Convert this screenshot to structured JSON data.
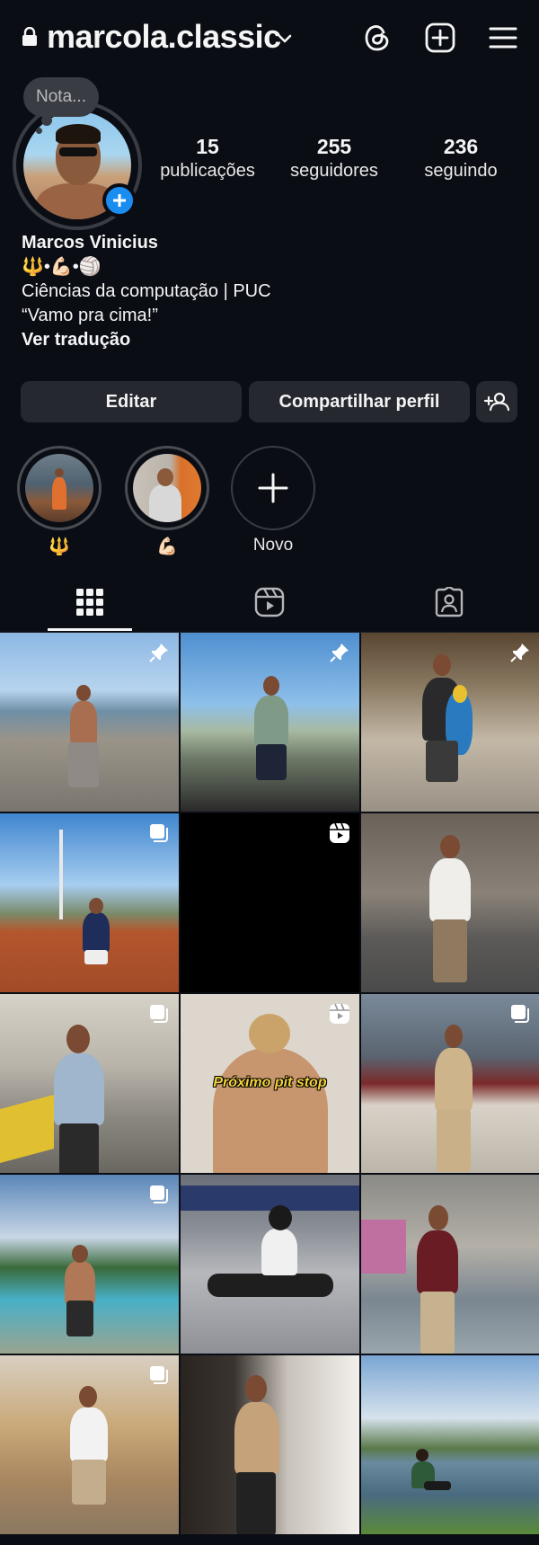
{
  "header": {
    "username": "marcola.classic",
    "icons": [
      "lock-icon",
      "chevron-down-icon",
      "threads-icon",
      "create-post-icon",
      "menu-icon"
    ]
  },
  "profile": {
    "note_placeholder": "Nota...",
    "stats": [
      {
        "value": "15",
        "label": "publicações"
      },
      {
        "value": "255",
        "label": "seguidores"
      },
      {
        "value": "236",
        "label": "seguindo"
      }
    ],
    "name": "Marcos Vinicius",
    "bio_emoji_line": "🔱•💪🏻•🏐",
    "bio_line_1": "Ciências da computação | PUC",
    "bio_line_2": "“Vamo pra cima!”",
    "translate_label": "Ver tradução"
  },
  "actions": {
    "edit_label": "Editar",
    "share_label": "Compartilhar perfil"
  },
  "highlights": [
    {
      "label": "🔱"
    },
    {
      "label": "💪🏻"
    },
    {
      "label": "Novo"
    }
  ],
  "tabs": [
    "grid-icon",
    "reels-icon",
    "tagged-icon"
  ],
  "posts": [
    {
      "badge": "pin-icon",
      "caption": ""
    },
    {
      "badge": "pin-icon",
      "caption": ""
    },
    {
      "badge": "pin-icon",
      "caption": ""
    },
    {
      "badge": "carousel-icon",
      "caption": ""
    },
    {
      "badge": "reel-icon",
      "caption": ""
    },
    {
      "badge": "",
      "caption": ""
    },
    {
      "badge": "carousel-icon",
      "caption": ""
    },
    {
      "badge": "reel-icon",
      "caption": "Próximo pit stop"
    },
    {
      "badge": "carousel-icon",
      "caption": ""
    },
    {
      "badge": "carousel-icon",
      "caption": ""
    },
    {
      "badge": "",
      "caption": ""
    },
    {
      "badge": "",
      "caption": ""
    },
    {
      "badge": "carousel-icon",
      "caption": ""
    },
    {
      "badge": "",
      "caption": ""
    },
    {
      "badge": "",
      "caption": ""
    }
  ],
  "colors": {
    "background": "#0b0d14",
    "button": "#26282f",
    "accent": "#1b8cf0"
  }
}
